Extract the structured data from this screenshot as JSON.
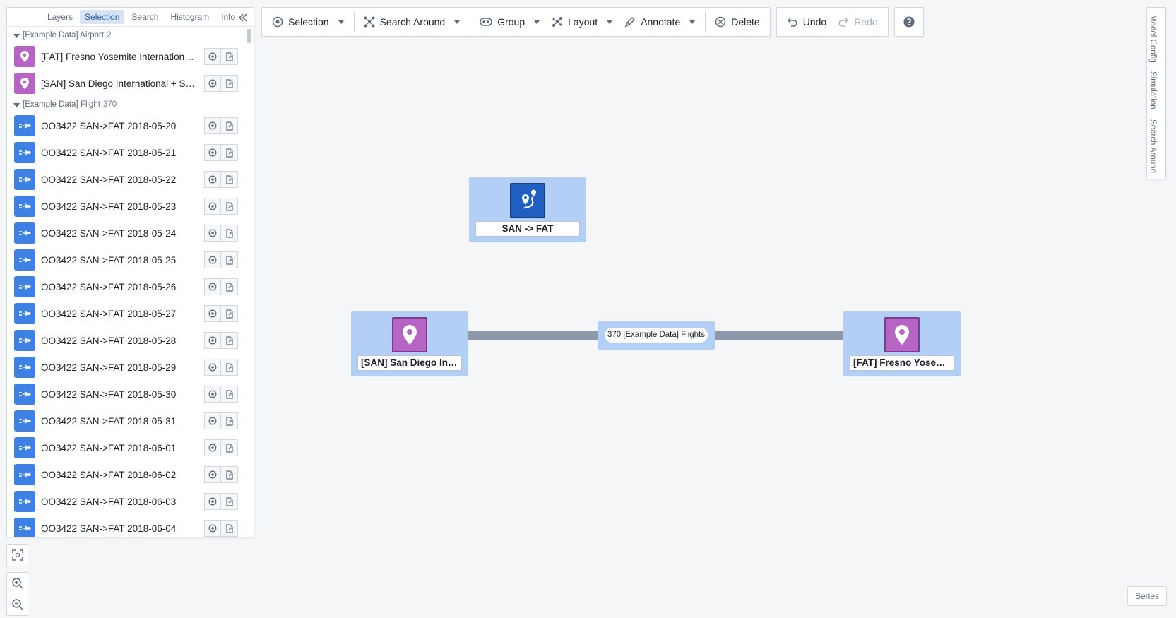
{
  "panel": {
    "tabs": [
      {
        "label": "Layers"
      },
      {
        "label": "Selection"
      },
      {
        "label": "Search"
      },
      {
        "label": "Histogram"
      },
      {
        "label": "Info"
      }
    ],
    "active_tab": "Selection",
    "groups": [
      {
        "title": "[Example Data] Airport",
        "count": "2",
        "icon": "map-pin-icon",
        "items": [
          {
            "label": "[FAT] Fresno Yosemite International + Fresno + CA"
          },
          {
            "label": "[SAN] San Diego International + San Diego + CA"
          }
        ]
      },
      {
        "title": "[Example Data] Flight",
        "count": "370",
        "icon": "flight-icon",
        "items": [
          {
            "label": "OO3422 SAN->FAT 2018-05-20"
          },
          {
            "label": "OO3422 SAN->FAT 2018-05-21"
          },
          {
            "label": "OO3422 SAN->FAT 2018-05-22"
          },
          {
            "label": "OO3422 SAN->FAT 2018-05-23"
          },
          {
            "label": "OO3422 SAN->FAT 2018-05-24"
          },
          {
            "label": "OO3422 SAN->FAT 2018-05-25"
          },
          {
            "label": "OO3422 SAN->FAT 2018-05-26"
          },
          {
            "label": "OO3422 SAN->FAT 2018-05-27"
          },
          {
            "label": "OO3422 SAN->FAT 2018-05-28"
          },
          {
            "label": "OO3422 SAN->FAT 2018-05-29"
          },
          {
            "label": "OO3422 SAN->FAT 2018-05-30"
          },
          {
            "label": "OO3422 SAN->FAT 2018-05-31"
          },
          {
            "label": "OO3422 SAN->FAT 2018-06-01"
          },
          {
            "label": "OO3422 SAN->FAT 2018-06-02"
          },
          {
            "label": "OO3422 SAN->FAT 2018-06-03"
          },
          {
            "label": "OO3422 SAN->FAT 2018-06-04"
          }
        ]
      }
    ]
  },
  "toolbar": {
    "selection_label": "Selection",
    "search_around_label": "Search Around",
    "group_label": "Group",
    "layout_label": "Layout",
    "annotate_label": "Annotate",
    "delete_label": "Delete",
    "undo_label": "Undo",
    "redo_label": "Redo"
  },
  "right_rail": {
    "items": [
      "Model Config",
      "Simulation",
      "Search Around"
    ]
  },
  "graph": {
    "route_node_label": "SAN -> FAT",
    "san_node_label": "[SAN] San Diego International + San Diego + CA",
    "fat_node_label": "[FAT] Fresno Yosemite International + Fresno + CA",
    "edge_label": "370 [Example Data] Flights"
  },
  "series_label": "Series",
  "colors": {
    "airport": "#b665c4",
    "flight": "#3f80e3",
    "node_bg": "#b3cff5",
    "edge": "#8d99ab",
    "active_tab": "#d8e4f4"
  }
}
